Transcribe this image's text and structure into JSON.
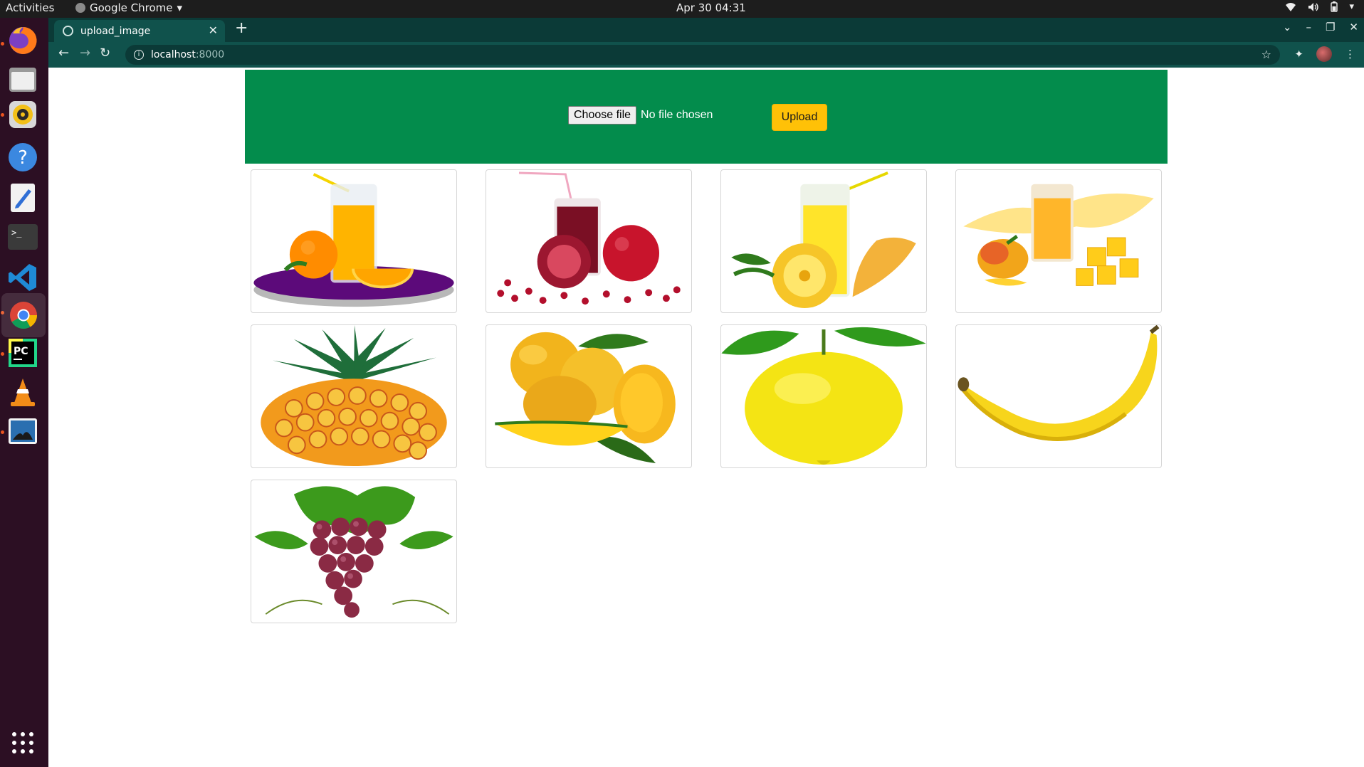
{
  "system_bar": {
    "activities": "Activities",
    "app_name": "Google Chrome",
    "clock": "Apr 30  04:31",
    "tray_icons": [
      "wifi-icon",
      "volume-icon",
      "battery-icon",
      "system-menu-icon"
    ]
  },
  "dock": {
    "apps": [
      {
        "name": "Firefox",
        "icon": "firefox-icon",
        "running": true
      },
      {
        "name": "Files",
        "icon": "files-icon",
        "running": false
      },
      {
        "name": "Rhythmbox",
        "icon": "rhythmbox-icon",
        "running": true
      },
      {
        "name": "Help",
        "icon": "help-icon",
        "running": false
      },
      {
        "name": "Text Editor",
        "icon": "text-editor-icon",
        "running": false
      },
      {
        "name": "Terminal",
        "icon": "terminal-icon",
        "running": false
      },
      {
        "name": "Visual Studio Code",
        "icon": "vscode-icon",
        "running": false
      },
      {
        "name": "Google Chrome",
        "icon": "chrome-icon",
        "running": true,
        "active": true
      },
      {
        "name": "PyCharm",
        "icon": "pycharm-icon",
        "running": true
      },
      {
        "name": "VLC",
        "icon": "vlc-icon",
        "running": false
      },
      {
        "name": "Shotwell",
        "icon": "shotwell-icon",
        "running": true
      }
    ],
    "show_apps_icon": "grid-icon"
  },
  "browser": {
    "tab_title": "upload_image",
    "url_host": "localhost",
    "url_port": ":8000",
    "theme_color": "#10524c"
  },
  "upload_form": {
    "choose_label": "Choose file",
    "status": "No file chosen",
    "submit_label": "Upload",
    "header_color": "#038c4c",
    "button_color": "#ffc107"
  },
  "gallery": [
    {
      "subject": "orange juice with orange slices"
    },
    {
      "subject": "pomegranate juice with pomegranates"
    },
    {
      "subject": "pineapple juice with pineapple slices"
    },
    {
      "subject": "mango juice with mango cubes"
    },
    {
      "subject": "pineapple"
    },
    {
      "subject": "mangoes"
    },
    {
      "subject": "lemon"
    },
    {
      "subject": "banana"
    },
    {
      "subject": "grapes"
    }
  ]
}
